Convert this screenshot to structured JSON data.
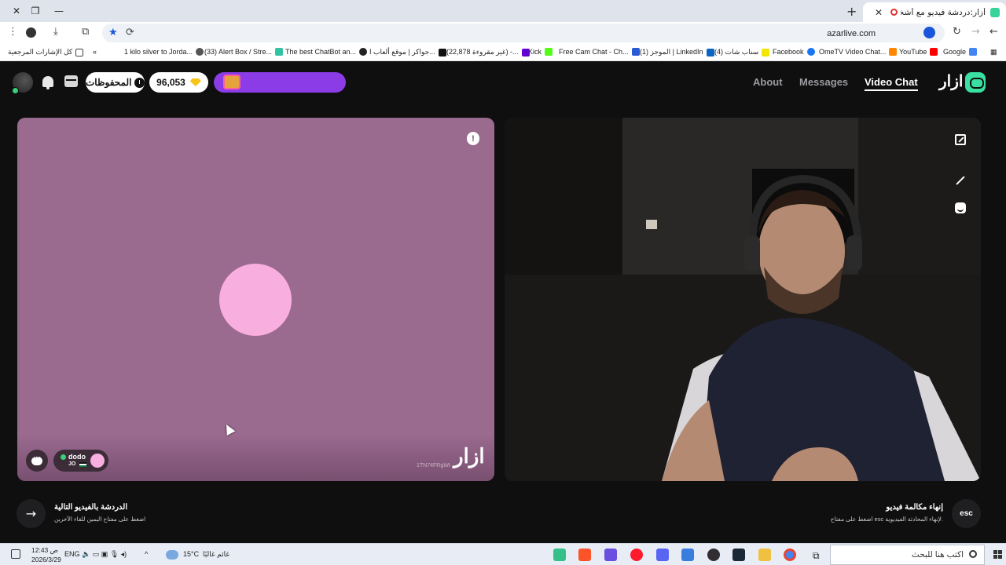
{
  "browser": {
    "tab_title": "أزار:دردشة فيديو مع أشخاص",
    "tab_close": "✕",
    "new_tab": "+",
    "window_controls": {
      "close": "✕",
      "restore": "❐",
      "minimize": "—"
    },
    "url": "azarlive.com",
    "bookmarks": [
      {
        "label": "Google",
        "icon": "google-icon",
        "color": "#4285f4"
      },
      {
        "label": "YouTube",
        "icon": "youtube-icon",
        "color": "#ff0000"
      },
      {
        "label": "OmeTV Video Chat...",
        "icon": "ometv-icon",
        "color": "#ff8800"
      },
      {
        "label": "Facebook",
        "icon": "facebook-icon",
        "color": "#1877f2"
      },
      {
        "label": "(4) سناب شات",
        "icon": "snapchat-icon",
        "color": "#fffc00"
      },
      {
        "label": "(1) الموجز | LinkedIn",
        "icon": "linkedin-icon",
        "color": "#0a66c2"
      },
      {
        "label": "Free Cam Chat - Ch...",
        "icon": "camchat-icon",
        "color": "#2a5bd7"
      },
      {
        "label": "Kick",
        "icon": "kick-icon",
        "color": "#53fc18"
      },
      {
        "label": "(22,878 غير مقروءة) -...",
        "icon": "yahoo-mail-icon",
        "color": "#6001d2"
      },
      {
        "label": "جواكر | موقع ألعاب ا...",
        "icon": "jawaker-icon",
        "color": "#111111"
      },
      {
        "label": "The best ChatBot an...",
        "icon": "chatbot-icon",
        "color": "#222222"
      },
      {
        "label": "(33) Alert Box / Stre...",
        "icon": "streamlabs-icon",
        "color": "#31c3a2"
      },
      {
        "label": "1 kilo silver to Jorda...",
        "icon": "silver-icon",
        "color": "#555555"
      }
    ],
    "bookmarks_overflow": "«",
    "all_bookmarks": "كل الإشارات المرجعية"
  },
  "app": {
    "logo_text": "ازار",
    "nav": {
      "video_chat": "Video Chat",
      "messages": "Messages",
      "about": "About"
    },
    "saved_label": "المحفوظات",
    "gems_count": "96,053",
    "partner": {
      "name": "dodo",
      "country": "JO",
      "report_glyph": "!",
      "watermark": "ازار",
      "session_id": "1TN74FRgWt",
      "avatar_color": "#f9aee0"
    },
    "next_hint": {
      "title": "الدردشة بالفيديو التالية",
      "subtitle": "اضغط على مفتاح اليمين للقاء الآخرين",
      "arrow": "→"
    },
    "end_hint": {
      "title": "إنهاء مكالمة فيديو",
      "subtitle": "اضغط على مفتاح esc لإنهاء المحادثة الفيديوية.",
      "key": "esc"
    }
  },
  "taskbar": {
    "search_placeholder": "اكتب هنا للبحث",
    "weather": "غائم غالبًا",
    "temperature": "15°C",
    "language": "ENG",
    "time": "12:43 ص",
    "date": "2026/3/29",
    "apps": [
      "teams-icon",
      "brave-icon",
      "app-icon",
      "opera-icon",
      "discord-icon",
      "store-icon",
      "obs-icon",
      "steam-icon",
      "file-explorer-icon",
      "chrome-icon"
    ]
  },
  "colors": {
    "accent": "#39e0a0",
    "promo": "#8c3ce6",
    "left_video_bg": "#9a6a8f"
  }
}
